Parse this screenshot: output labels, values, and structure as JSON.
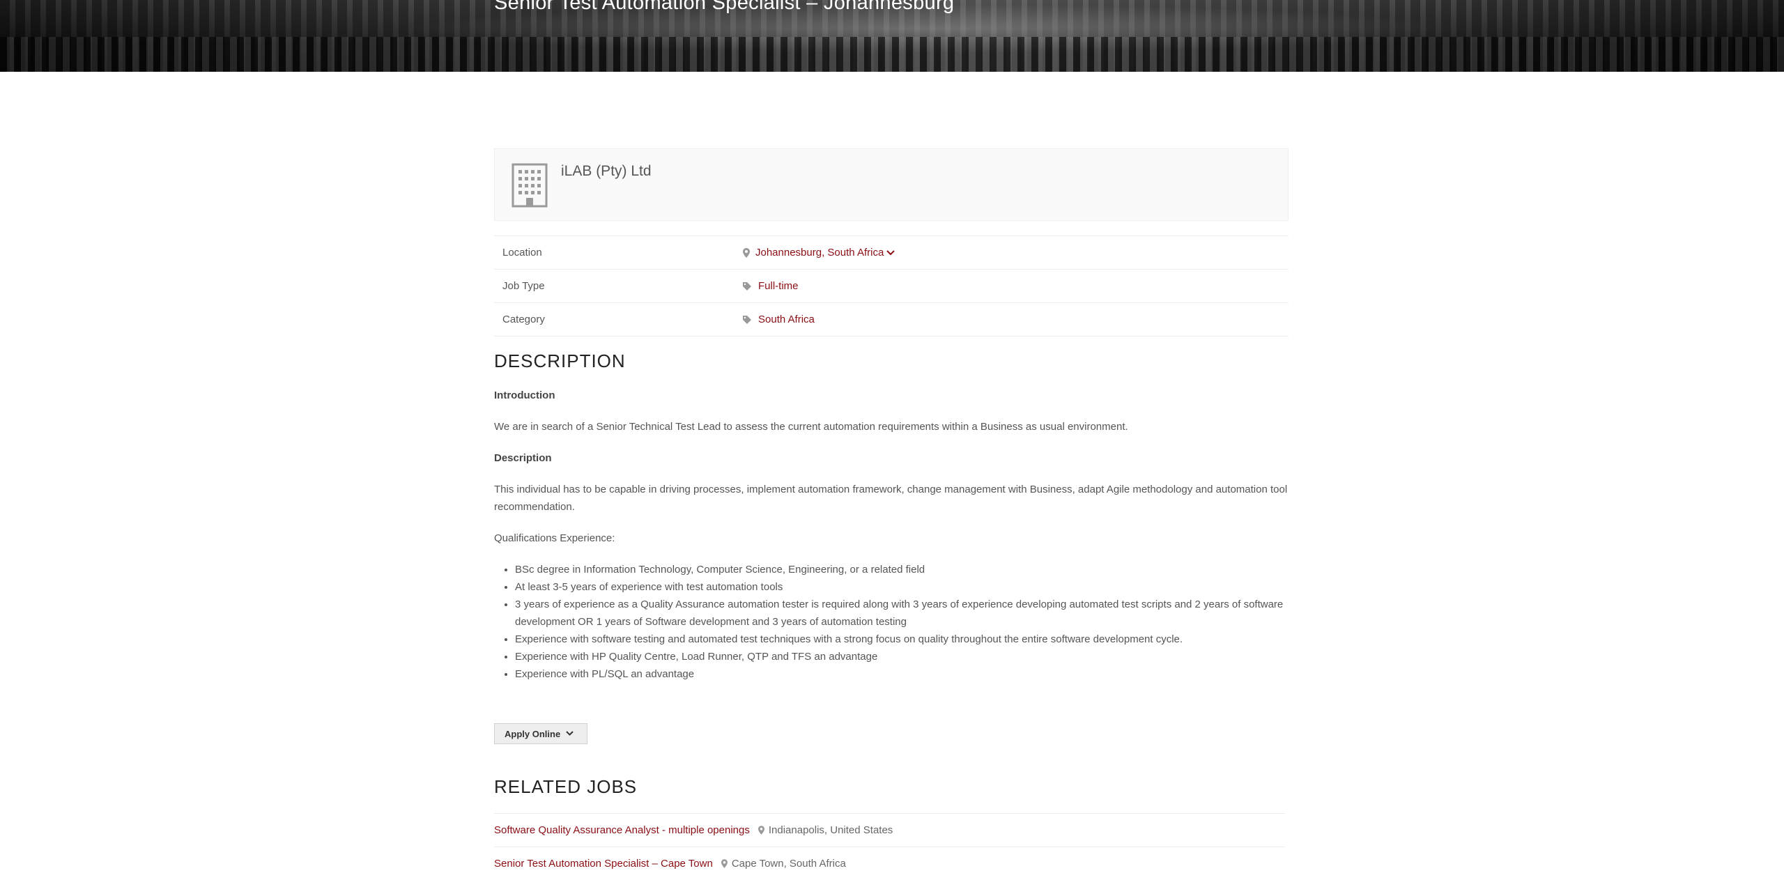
{
  "hero": {
    "title": "Senior Test Automation Specialist – Johannesburg"
  },
  "company": {
    "name": "iLAB (Pty) Ltd",
    "icon": "building-icon"
  },
  "meta": [
    {
      "label": "Location",
      "value": "Johannesburg, South Africa",
      "icon": "map-pin-icon"
    },
    {
      "label": "Job Type",
      "value": "Full-time",
      "icon": "tag-icon"
    },
    {
      "label": "Category",
      "value": "South Africa",
      "icon": "tag-icon"
    }
  ],
  "description": {
    "heading": "DESCRIPTION",
    "intro_heading": "Introduction",
    "intro_text": "We are in search of a Senior Technical Test Lead to assess the current automation requirements within a Business as usual environment.",
    "desc_heading": "Description",
    "desc_text": "This individual has to be capable in driving processes, implement automation framework, change management with Business, adapt Agile methodology and automation tool recommendation.",
    "qual_heading": "Qualifications Experience:",
    "qualifications": [
      "BSc degree in Information Technology, Computer Science, Engineering, or a related field",
      "At least 3-5 years of experience with test automation tools",
      "3 years of experience as a Quality Assurance automation tester is required along with 3 years of experience developing automated test scripts and 2 years of software development OR 1 years of Software development and 3 years of automation testing",
      "Experience with software testing and automated test techniques with a strong focus on quality throughout the entire software development cycle.",
      "Experience with HP Quality Centre, Load Runner, QTP and TFS an advantage",
      "Experience with PL/SQL an advantage"
    ]
  },
  "apply": {
    "label": "Apply Online"
  },
  "related": {
    "heading": "RELATED JOBS",
    "jobs": [
      {
        "title": "Software Quality Assurance Analyst - multiple openings",
        "location": "Indianapolis, United States"
      },
      {
        "title": "Senior Test Automation Specialist – Cape Town",
        "location": "Cape Town, South Africa"
      }
    ]
  },
  "colors": {
    "accent": "#8b0e14",
    "text": "#555555",
    "heading": "#222222"
  }
}
